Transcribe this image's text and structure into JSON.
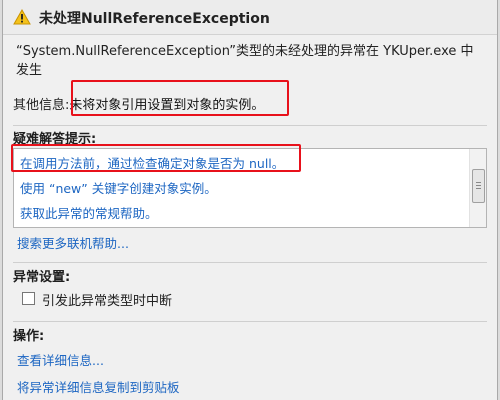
{
  "window": {
    "title": "未处理NullReferenceException"
  },
  "description": "“System.NullReferenceException”类型的未经处理的异常在 YKUper.exe 中发生",
  "additional_info": {
    "label": "其他信息:",
    "value": "未将对象引用设置到对象的实例。"
  },
  "troubleshooting": {
    "title": "疑难解答提示:",
    "tips": [
      "在调用方法前，通过检查确定对象是否为 null。",
      "使用 “new” 关键字创建对象实例。",
      "获取此异常的常规帮助。"
    ],
    "search_link": "搜索更多联机帮助..."
  },
  "exception_settings": {
    "title": "异常设置:",
    "break_checkbox_label": "引发此异常类型时中断",
    "break_checked": false
  },
  "actions": {
    "title": "操作:",
    "view_details": "查看详细信息...",
    "copy_details": "将异常详细信息复制到剪贴板"
  },
  "colors": {
    "link": "#1d66c2",
    "highlight": "#e8111b",
    "warning": "#f4c21b"
  }
}
